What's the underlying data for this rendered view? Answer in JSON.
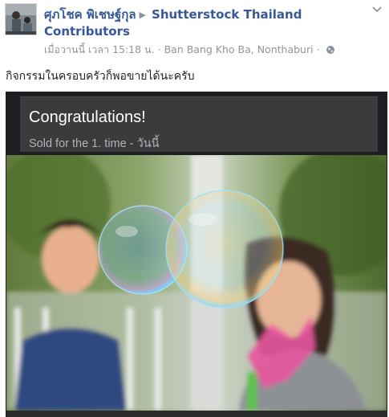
{
  "post": {
    "author": "ศุภโชค พิเชษฐ์กุล",
    "target_line1": "Shutterstock Thailand",
    "target_line2": "Contributors",
    "timestamp": "เมื่อวานนี้ เวลา 15:18 น.",
    "location": "Ban Bang Kho Ba, Nonthaburi",
    "separator": "·",
    "text": "กิจกรรมในครอบครัวก็พอขายได้นะครับ"
  },
  "card": {
    "title": "Congratulations!",
    "subtitle": "Sold for the 1. time - วันนี้"
  },
  "icons": {
    "target_arrow": "play-triangle-icon",
    "privacy": "globe-icon",
    "options": "chevron-down-icon"
  },
  "colors": {
    "link": "#365899",
    "meta": "#90949c",
    "card_bg": "#1c1e21",
    "card_header": "#3a3b3d"
  }
}
